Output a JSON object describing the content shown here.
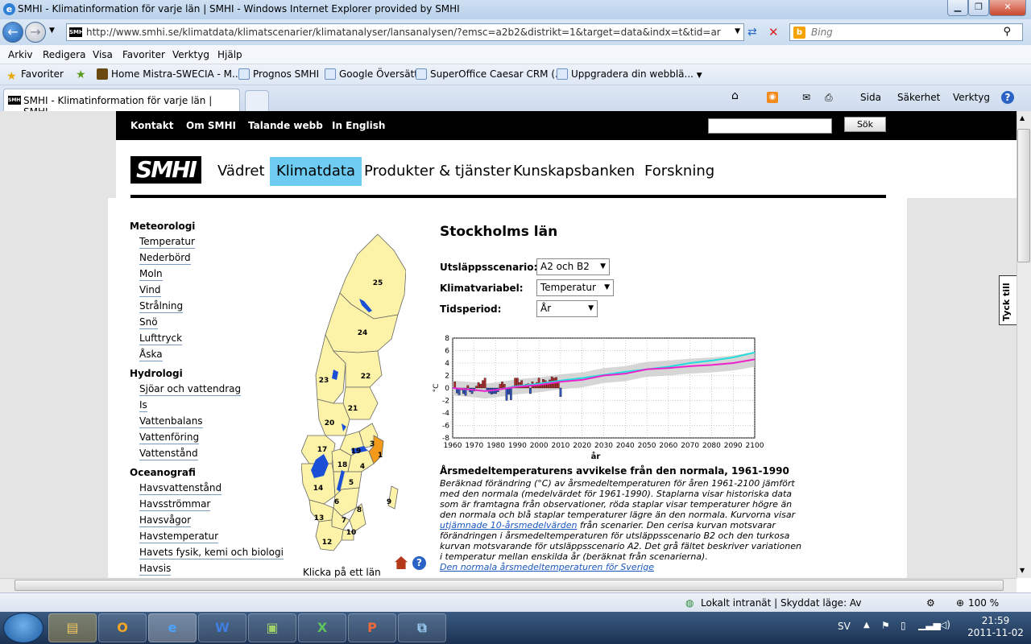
{
  "browser": {
    "title": "SMHI - Klimatinformation för varje län | SMHI - Windows Internet Explorer provided by SMHI",
    "url": "http://www.smhi.se/klimatdata/klimatscenarier/klimatanalyser/lansanalysen/?emsc=a2b2&distrikt=1&target=data&indx=t&tid=ar",
    "search_placeholder": "Bing",
    "menu": [
      "Arkiv",
      "Redigera",
      "Visa",
      "Favoriter",
      "Verktyg",
      "Hjälp"
    ],
    "favorites_label": "Favoriter",
    "favorites": [
      "Home Mistra-SWECIA - M...",
      "Prognos  SMHI",
      "Google Översätt",
      "SuperOffice Caesar CRM (...",
      "Uppgradera din webblä..."
    ],
    "tab_title": "SMHI - Klimatinformation för varje län | SMHI",
    "commands": [
      "Sida",
      "Säkerhet",
      "Verktyg"
    ],
    "status_zone": "Lokalt intranät | Skyddat läge: Av",
    "zoom": "100 %"
  },
  "site": {
    "topnav": [
      "Kontakt",
      "Om SMHI",
      "Talande webb",
      "In English"
    ],
    "search_button": "Sök",
    "logo": "SMHI",
    "mainnav": [
      "Vädret",
      "Klimatdata",
      "Produkter & tjänster",
      "Kunskapsbanken",
      "Forskning"
    ],
    "active_nav": "Klimatdata",
    "feedback_tab": "Tyck till"
  },
  "leftmenu": {
    "sections": [
      {
        "heading": "Meteorologi",
        "items": [
          "Temperatur",
          "Nederbörd",
          "Moln",
          "Vind",
          "Strålning",
          "Snö",
          "Lufttryck",
          "Åska"
        ]
      },
      {
        "heading": "Hydrologi",
        "items": [
          "Sjöar och vattendrag",
          "Is",
          "Vattenbalans",
          "Vattenföring",
          "Vattenstånd"
        ]
      },
      {
        "heading": "Oceanografi",
        "items": [
          "Havsvattenstånd",
          "Havsströmmar",
          "Havsvågor",
          "Havstemperatur",
          "Havets fysik, kemi och biologi",
          "Havsis"
        ]
      }
    ]
  },
  "map": {
    "hint": "Klicka på ett län",
    "labels": [
      "25",
      "24",
      "23",
      "22",
      "21",
      "20",
      "3",
      "19",
      "1",
      "17",
      "18",
      "4",
      "14",
      "5",
      "6",
      "9",
      "13",
      "7",
      "8",
      "10",
      "12"
    ]
  },
  "region": {
    "title": "Stockholms län",
    "scenario_label": "Utsläppsscenario:",
    "scenario_value": "A2 och B2",
    "variable_label": "Klimatvariabel:",
    "variable_value": "Temperatur",
    "period_label": "Tidsperiod:",
    "period_value": "År",
    "desc_title": "Årsmedeltemperaturens avvikelse från den normala, 1961-1990",
    "desc_part1": "Beräknad förändring (°C) av årsmedeltemperaturen för åren 1961-2100 jämfört med den normala (medelvärdet för 1961-1990). Staplarna visar historiska data som är framtagna från observationer, röda staplar visar temperaturer högre än den normala och blå staplar temperaturer lägre än den normala. Kurvorna visar ",
    "desc_link": "utjämnade 10-årsmedelvärden",
    "desc_part2": " från scenarier. Den cerisa kurvan motsvarar förändringen i årsmedeltemperaturen för utsläppsscenario B2 och den turkosa kurvan motsvarande för utsläppsscenario A2. Det grå fältet beskriver variationen i temperatur mellan enskilda år (beräknat från scenarierna).",
    "desc_more": "Den normala årsmedeltemperaturen för Sverige"
  },
  "chart_data": {
    "type": "line",
    "ylabel": "°C",
    "xlabel": "år",
    "xlim": [
      1960,
      2100
    ],
    "ylim": [
      -8,
      8
    ],
    "xticks": [
      "1960",
      "1970",
      "1980",
      "1990",
      "2000",
      "2010",
      "2020",
      "2030",
      "2040",
      "2050",
      "2060",
      "2070",
      "2080",
      "2090",
      "2100"
    ],
    "yticks": [
      "8",
      "6",
      "4",
      "2",
      "0",
      "-2",
      "-4",
      "-6",
      "-8"
    ],
    "grid": true,
    "observed_bars": {
      "x": [
        1961,
        1962,
        1963,
        1964,
        1965,
        1966,
        1967,
        1968,
        1969,
        1970,
        1971,
        1972,
        1973,
        1974,
        1975,
        1976,
        1977,
        1978,
        1979,
        1980,
        1981,
        1982,
        1983,
        1984,
        1985,
        1986,
        1987,
        1988,
        1989,
        1990,
        1991,
        1992,
        1993,
        1994,
        1995,
        1996,
        1997,
        1998,
        1999,
        2000,
        2001,
        2002,
        2003,
        2004,
        2005,
        2006,
        2007,
        2008,
        2009,
        2010
      ],
      "values": [
        1.0,
        -0.8,
        -1.1,
        -0.3,
        -0.9,
        -1.2,
        0.4,
        -0.6,
        -0.9,
        -0.5,
        0.3,
        0.9,
        0.6,
        1.2,
        1.6,
        -0.5,
        -0.8,
        -1.0,
        -0.9,
        -0.9,
        -0.6,
        0.6,
        1.0,
        0.6,
        -2.0,
        -1.0,
        -1.9,
        0.3,
        1.6,
        1.6,
        0.9,
        1.2,
        0.4,
        0.6,
        0.7,
        -0.9,
        1.0,
        0.5,
        0.9,
        1.6,
        0.8,
        1.4,
        1.2,
        1.0,
        1.3,
        1.8,
        1.6,
        1.7,
        0.9,
        -1.4
      ],
      "positive_color": "#b03030",
      "negative_color": "#3355bb"
    },
    "series": [
      {
        "name": "B2",
        "color": "#ee22cc",
        "x": [
          1960,
          1970,
          1975,
          1980,
          1990,
          2000,
          2010,
          2020,
          2030,
          2040,
          2050,
          2060,
          2070,
          2080,
          2090,
          2100
        ],
        "values": [
          0.0,
          -0.3,
          -0.5,
          -0.3,
          0.2,
          0.5,
          1.0,
          1.3,
          2.0,
          2.3,
          3.0,
          3.2,
          3.5,
          3.7,
          4.0,
          4.6
        ]
      },
      {
        "name": "A2",
        "color": "#22dddd",
        "x": [
          1960,
          1970,
          1975,
          1980,
          1990,
          2000,
          2010,
          2020,
          2030,
          2040,
          2050,
          2060,
          2070,
          2080,
          2090,
          2100
        ],
        "values": [
          0.0,
          -0.3,
          -0.5,
          -0.3,
          0.3,
          0.7,
          1.2,
          1.6,
          2.1,
          2.6,
          3.0,
          3.4,
          4.0,
          4.4,
          4.9,
          5.7
        ]
      }
    ],
    "range_band": {
      "color": "#cccccc",
      "half_width": 1.2
    }
  },
  "taskbar": {
    "apps": [
      "Explorer",
      "Outlook",
      "Internet Explorer",
      "Word",
      "Folder",
      "Excel",
      "PowerPoint",
      "Remote"
    ],
    "language": "SV",
    "time": "21:59",
    "date": "2011-11-02"
  }
}
